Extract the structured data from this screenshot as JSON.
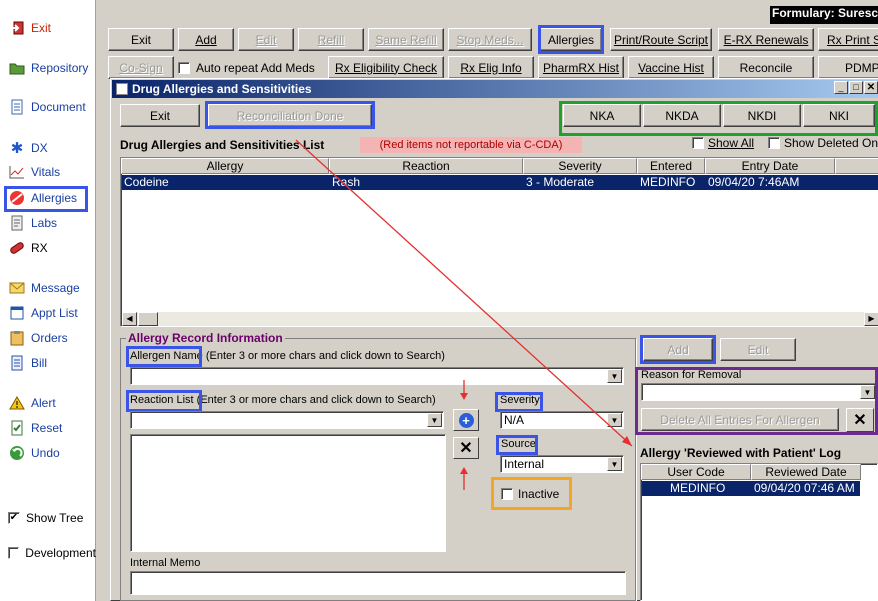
{
  "formulary": "Formulary: Surescri",
  "sidebar": {
    "items": [
      {
        "label": "Exit",
        "icon": "exit-icon",
        "color": "#cc2200"
      },
      {
        "label": "Repository",
        "icon": "folder-icon"
      },
      {
        "label": "Document",
        "icon": "document-icon"
      },
      {
        "label": "DX",
        "icon": "medical-star-icon"
      },
      {
        "label": "Vitals",
        "icon": "vitals-chart-icon"
      },
      {
        "label": "Allergies",
        "icon": "allergy-pill-icon"
      },
      {
        "label": "Labs",
        "icon": "labs-icon"
      },
      {
        "label": "RX",
        "icon": "rx-capsule-icon"
      },
      {
        "label": "Message",
        "icon": "envelope-icon"
      },
      {
        "label": "Appt List",
        "icon": "calendar-icon"
      },
      {
        "label": "Orders",
        "icon": "clipboard-icon"
      },
      {
        "label": "Bill",
        "icon": "bill-icon"
      },
      {
        "label": "Alert",
        "icon": "warning-icon"
      },
      {
        "label": "Reset",
        "icon": "reset-icon"
      },
      {
        "label": "Undo",
        "icon": "undo-icon"
      }
    ],
    "show_tree": "Show Tree",
    "development": "Development"
  },
  "toolbar": {
    "row1": [
      "Exit",
      "Add",
      "Edit",
      "Refill",
      "Same Refill",
      "Stop Meds...",
      "Allergies",
      "Print/Route Script",
      "E-RX Renewals",
      "Rx Print Se"
    ],
    "row2": [
      "Co-Sign",
      "Auto repeat Add Meds",
      "Rx Eligibility Check",
      "Rx Elig Info",
      "PharmRX Hist",
      "Vaccine Hist",
      "Reconcile",
      "PDMP"
    ]
  },
  "dialog": {
    "title": "Drug Allergies and Sensitivities",
    "exit": "Exit",
    "reconciliation_done": "Reconciliation Done",
    "nka": "NKA",
    "nkda": "NKDA",
    "nkdi": "NKDI",
    "nki": "NKI",
    "show_all": "Show All",
    "show_deleted_only": "Show Deleted Only",
    "list_title": "Drug Allergies and Sensitivities List",
    "red_note": "(Red items not reportable via C-CDA)",
    "columns": [
      "Allergy",
      "Reaction",
      "Severity",
      "Entered",
      "Entry Date"
    ],
    "rows": [
      [
        "Codeine",
        "Rash",
        "3 - Moderate",
        "MEDINFO",
        "09/04/20 7:46AM"
      ]
    ],
    "record_info_title": "Allergy Record Information",
    "allergen_name": "Allergen Name",
    "allergen_hint": "(Enter 3 or more chars and click down to Search)",
    "reaction_list": "Reaction List",
    "reaction_hint": "(Enter 3 or more chars and click down to Search)",
    "severity": "Severity",
    "severity_value": "N/A",
    "source": "Source",
    "source_value": "Internal",
    "inactive": "Inactive",
    "internal_memo": "Internal Memo",
    "add": "Add",
    "edit": "Edit",
    "reason_for_removal": "Reason for Removal",
    "delete_all": "Delete All Entries For Allergen",
    "log_title": "Allergy 'Reviewed with Patient' Log",
    "log_columns": [
      "User Code",
      "Reviewed Date"
    ],
    "log_rows": [
      [
        "MEDINFO",
        "09/04/20 07:46 AM"
      ]
    ]
  }
}
